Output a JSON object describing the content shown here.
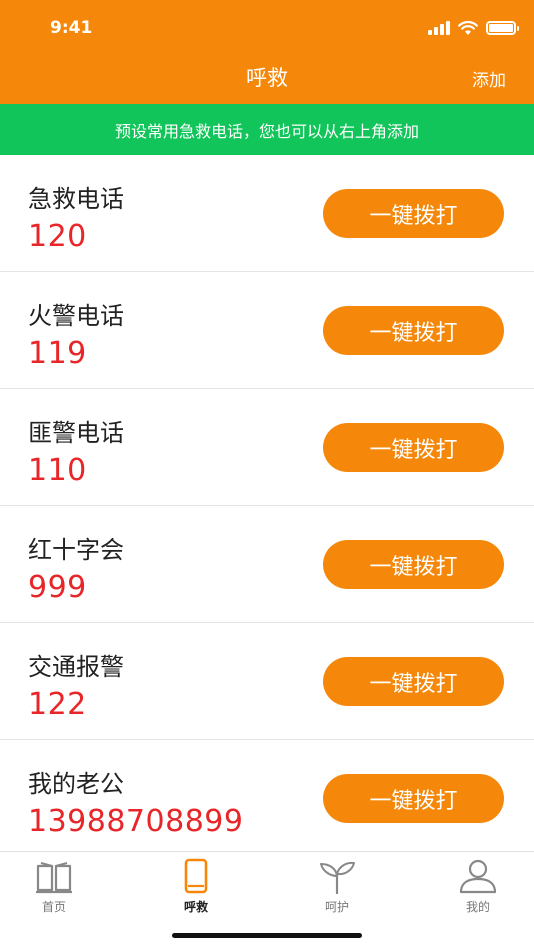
{
  "status_bar": {
    "time": "9:41"
  },
  "nav": {
    "title": "呼救",
    "add_label": "添加"
  },
  "notice": "预设常用急救电话，您也可以从右上角添加",
  "call_label": "一键拨打",
  "contacts": [
    {
      "name": "急救电话",
      "number": "120"
    },
    {
      "name": "火警电话",
      "number": "119"
    },
    {
      "name": "匪警电话",
      "number": "110"
    },
    {
      "name": "红十字会",
      "number": "999"
    },
    {
      "name": "交通报警",
      "number": "122"
    },
    {
      "name": "我的老公",
      "number": "13988708899"
    }
  ],
  "tabs": [
    {
      "label": "首页",
      "icon": "book-icon",
      "active": false
    },
    {
      "label": "呼救",
      "icon": "phone-icon",
      "active": true
    },
    {
      "label": "呵护",
      "icon": "sprout-icon",
      "active": false
    },
    {
      "label": "我的",
      "icon": "user-icon",
      "active": false
    }
  ],
  "colors": {
    "primary": "#f5880a",
    "notice_bg": "#12c55a",
    "number": "#e8262a"
  }
}
